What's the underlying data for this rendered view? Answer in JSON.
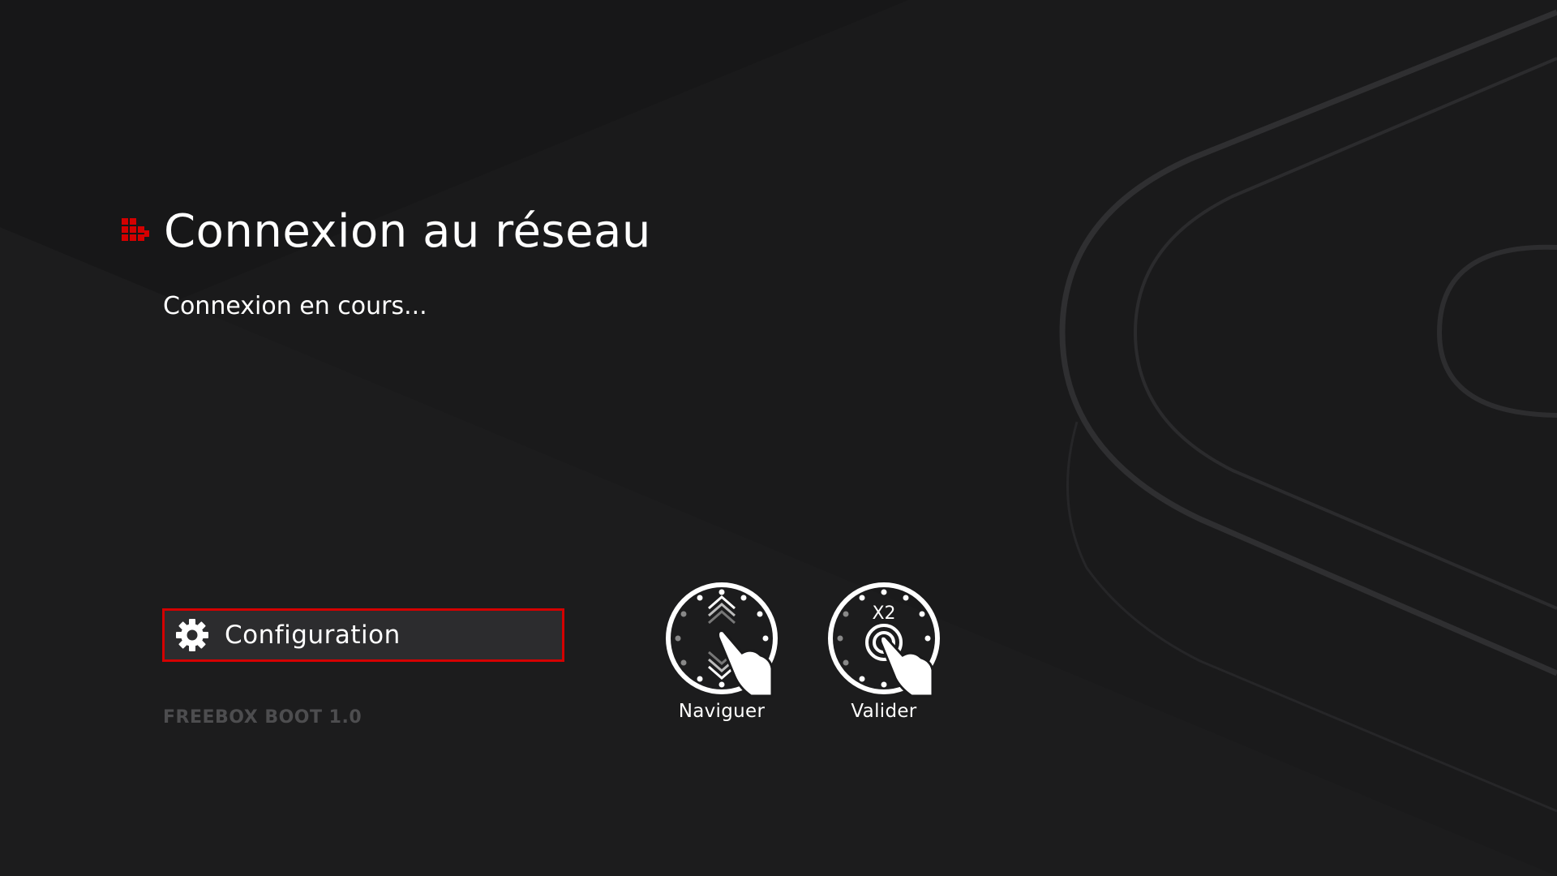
{
  "header": {
    "title": "Connexion au réseau",
    "status": "Connexion en cours..."
  },
  "actions": {
    "configuration_label": "Configuration"
  },
  "footer": {
    "version": "FREEBOX BOOT 1.0"
  },
  "hints": {
    "navigate_label": "Naviguer",
    "validate_label": "Valider",
    "validate_multiplier": "X2"
  },
  "icons": {
    "brand": "freebox-logo-icon",
    "settings": "gear-icon",
    "navigate": "dial-navigate-icon",
    "validate": "dial-double-press-icon"
  },
  "colors": {
    "background": "#1a1a1b",
    "accent": "#d40000",
    "text": "#ffffff",
    "muted": "#4d4d4f"
  }
}
